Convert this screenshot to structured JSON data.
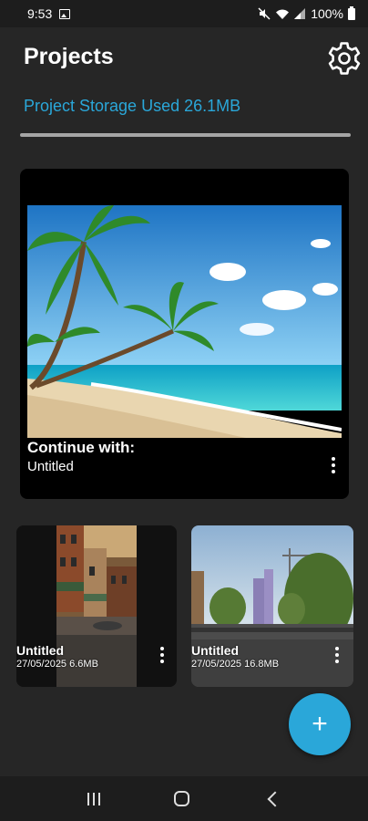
{
  "status_bar": {
    "time": "9:53",
    "battery": "100%"
  },
  "header": {
    "title": "Projects",
    "settings_icon": "gear-icon"
  },
  "storage": {
    "label": "Project Storage Used 26.1MB"
  },
  "featured": {
    "caption": "Continue with:",
    "name": "Untitled",
    "menu_icon": "more-vertical-icon"
  },
  "projects": [
    {
      "title": "Untitled",
      "date": "27/05/2025",
      "size": "6.6MB"
    },
    {
      "title": "Untitled",
      "date": "27/05/2025",
      "size": "16.8MB"
    }
  ],
  "fab": {
    "label": "+"
  },
  "colors": {
    "accent": "#2aa7d9",
    "background": "#262626",
    "bar": "#1d1d1d"
  }
}
